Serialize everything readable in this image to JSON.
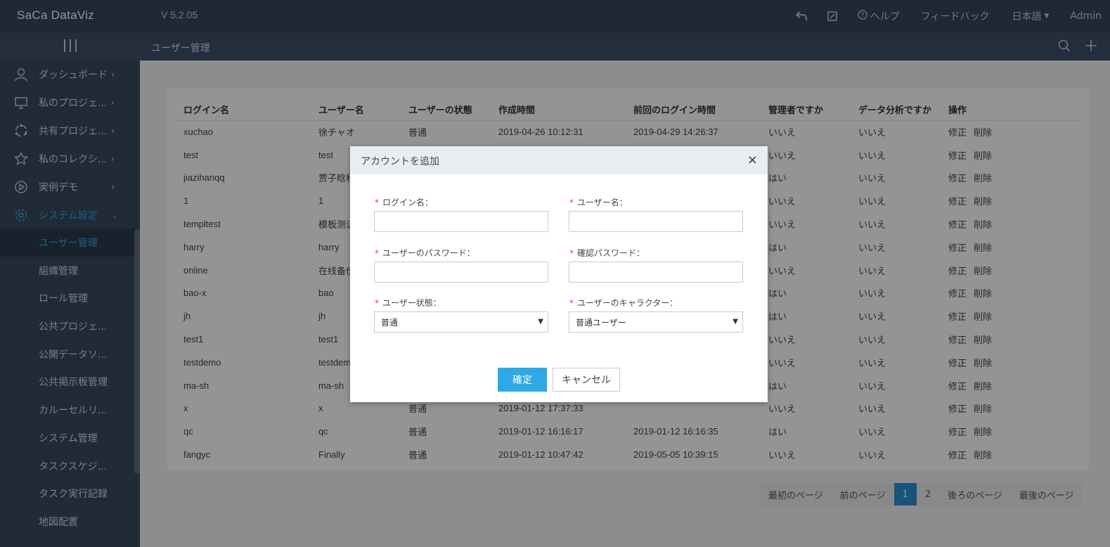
{
  "header": {
    "logo": "SaCa DataViz",
    "version": "V 5.2.05",
    "help": "ヘルプ",
    "feedback": "フィードバック",
    "language": "日本語",
    "user": "Admin"
  },
  "subbar": {
    "page_title": "ユーザー管理"
  },
  "sidebar": {
    "items": [
      {
        "label": "ダッシュボード",
        "icon": "user-icon"
      },
      {
        "label": "私のプロジェ...",
        "icon": "monitor-icon"
      },
      {
        "label": "共有プロジェ...",
        "icon": "share-icon"
      },
      {
        "label": "私のコレクシ...",
        "icon": "star-icon"
      },
      {
        "label": "実例デモ",
        "icon": "play-icon"
      },
      {
        "label": "システム設定",
        "icon": "gear-icon"
      }
    ],
    "sub_items": [
      "ユーザー管理",
      "組織管理",
      "ロール管理",
      "公共プロジェ...",
      "公開データソ...",
      "公共掲示板管理",
      "カルーセルリ...",
      "システム管理",
      "タスクスケジ...",
      "タスク実行記録",
      "地図配置"
    ]
  },
  "table": {
    "headers": [
      "ログイン名",
      "ユーザー名",
      "ユーザーの状態",
      "作成時間",
      "前回のログイン時間",
      "管理者ですか",
      "データ分析ですか",
      "操作"
    ],
    "edit_label": "修正",
    "delete_label": "削除",
    "rows": [
      [
        "xuchao",
        "徐チャオ",
        "普通",
        "2019-04-26 10:12:31",
        "2019-04-29 14:26:37",
        "いいえ",
        "いいえ"
      ],
      [
        "test",
        "test",
        "",
        "",
        "",
        "いいえ",
        "いいえ"
      ],
      [
        "jiazihanqq",
        "贾子晗科",
        "",
        "",
        "",
        "はい",
        "いいえ"
      ],
      [
        "1",
        "1",
        "",
        "",
        "",
        "いいえ",
        "いいえ"
      ],
      [
        "templtest",
        "模板测试",
        "",
        "",
        "",
        "いいえ",
        "いいえ"
      ],
      [
        "harry",
        "harry",
        "",
        "",
        "",
        "はい",
        "いいえ"
      ],
      [
        "online",
        "在线备份",
        "",
        "",
        "",
        "いいえ",
        "いいえ"
      ],
      [
        "bao-x",
        "bao",
        "",
        "",
        "",
        "はい",
        "いいえ"
      ],
      [
        "jh",
        "jh",
        "",
        "",
        "",
        "はい",
        "いいえ"
      ],
      [
        "test1",
        "test1",
        "",
        "",
        "",
        "いいえ",
        "いいえ"
      ],
      [
        "testdemo",
        "testdemo",
        "",
        "",
        "",
        "いいえ",
        "いいえ"
      ],
      [
        "ma-sh",
        "ma-sh",
        "",
        "",
        "",
        "はい",
        "いいえ"
      ],
      [
        "x",
        "x",
        "普通",
        "2019-01-12 17:37:33",
        "",
        "いいえ",
        "いいえ"
      ],
      [
        "qc",
        "qc",
        "普通",
        "2019-01-12 16:16:17",
        "2019-01-12 16:16:35",
        "はい",
        "いいえ"
      ],
      [
        "fangyc",
        "Finally",
        "普通",
        "2019-01-12 10:47:42",
        "2019-05-05 10:39:15",
        "いいえ",
        "いいえ"
      ]
    ]
  },
  "pagination": {
    "first": "最初のページ",
    "prev": "前のページ",
    "pages": [
      "1",
      "2"
    ],
    "next": "後ろのページ",
    "last": "最後のページ"
  },
  "modal": {
    "title": "アカウントを追加",
    "close": "×",
    "required_mark": "*",
    "login_name_label": "ログイン名：",
    "user_name_label": "ユーザー名：",
    "password_label": "ユーザーのパスワード：",
    "confirm_password_label": "確認パスワード：",
    "status_label": "ユーザー状態：",
    "status_value": "普通",
    "character_label": "ユーザーのキャラクター：",
    "character_value": "普通ユーザー",
    "ok_label": "確定",
    "cancel_label": "キャンセル"
  },
  "colors": {
    "topbar": "#36465e",
    "sidebar": "#3a495f",
    "accent": "#2ea8e6",
    "required": "#e04545"
  }
}
